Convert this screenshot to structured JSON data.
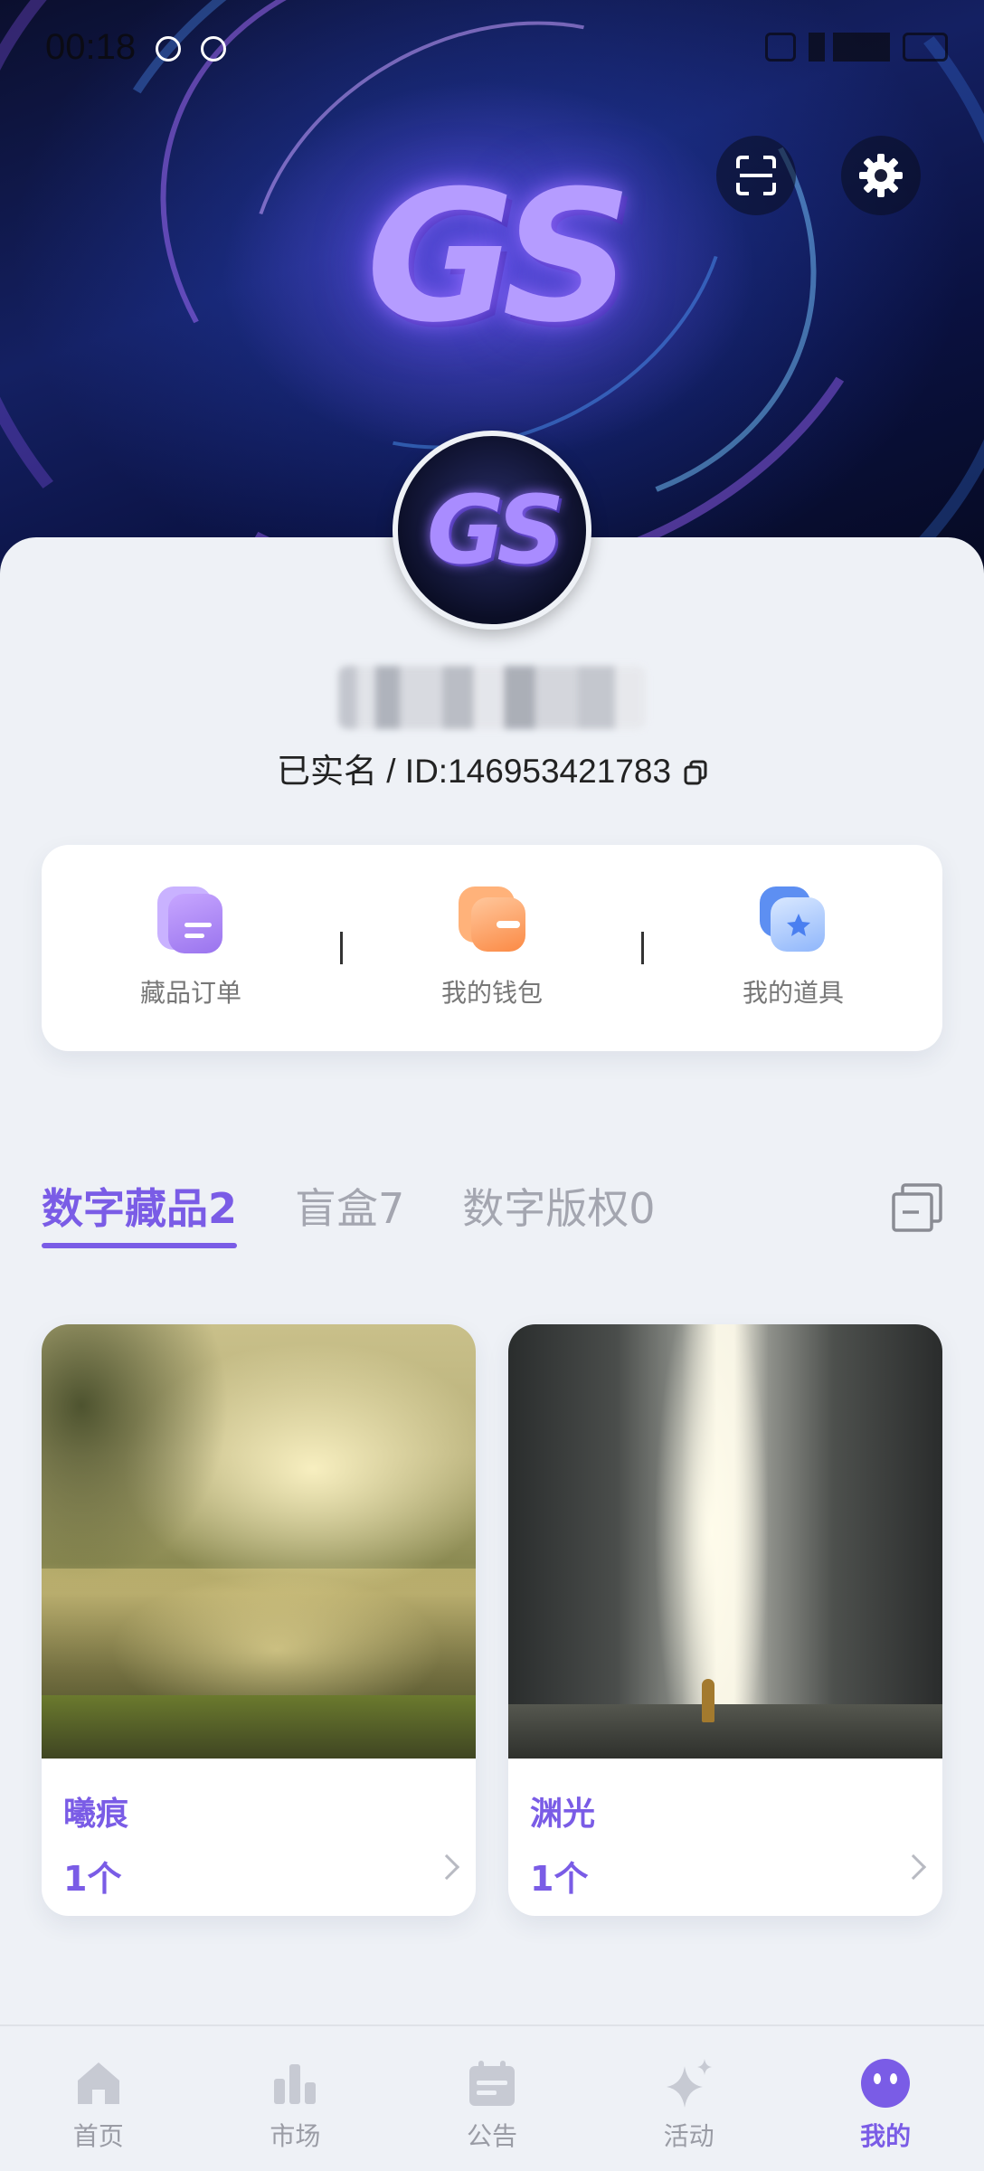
{
  "status_bar": {
    "time": "00:18"
  },
  "header": {
    "banner_logo": "GS",
    "scan_icon": "scan-icon",
    "settings_icon": "gear-icon"
  },
  "profile": {
    "avatar_text": "GS",
    "id_line": "已实名 / ID:146953421783"
  },
  "quick_actions": [
    {
      "label": "藏品订单",
      "icon": "document-icon",
      "color": "#a985f5"
    },
    {
      "label": "我的钱包",
      "icon": "wallet-icon",
      "color": "#fb9a5a"
    },
    {
      "label": "我的道具",
      "icon": "star-box-icon",
      "color": "#5d95f4"
    }
  ],
  "tabs": [
    {
      "label": "数字藏品2",
      "active": true
    },
    {
      "label": "盲盒7",
      "active": false
    },
    {
      "label": "数字版权0",
      "active": false
    }
  ],
  "collections": [
    {
      "title": "曦痕",
      "count": "1个"
    },
    {
      "title": "渊光",
      "count": "1个"
    }
  ],
  "bottom_nav": [
    {
      "label": "首页",
      "icon": "home-icon"
    },
    {
      "label": "市场",
      "icon": "bar-chart-icon"
    },
    {
      "label": "公告",
      "icon": "calendar-icon"
    },
    {
      "label": "活动",
      "icon": "sparkle-icon"
    },
    {
      "label": "我的",
      "icon": "smiley-icon",
      "active": true
    }
  ],
  "colors": {
    "accent": "#7a5ce6",
    "background": "#eef1f6"
  }
}
